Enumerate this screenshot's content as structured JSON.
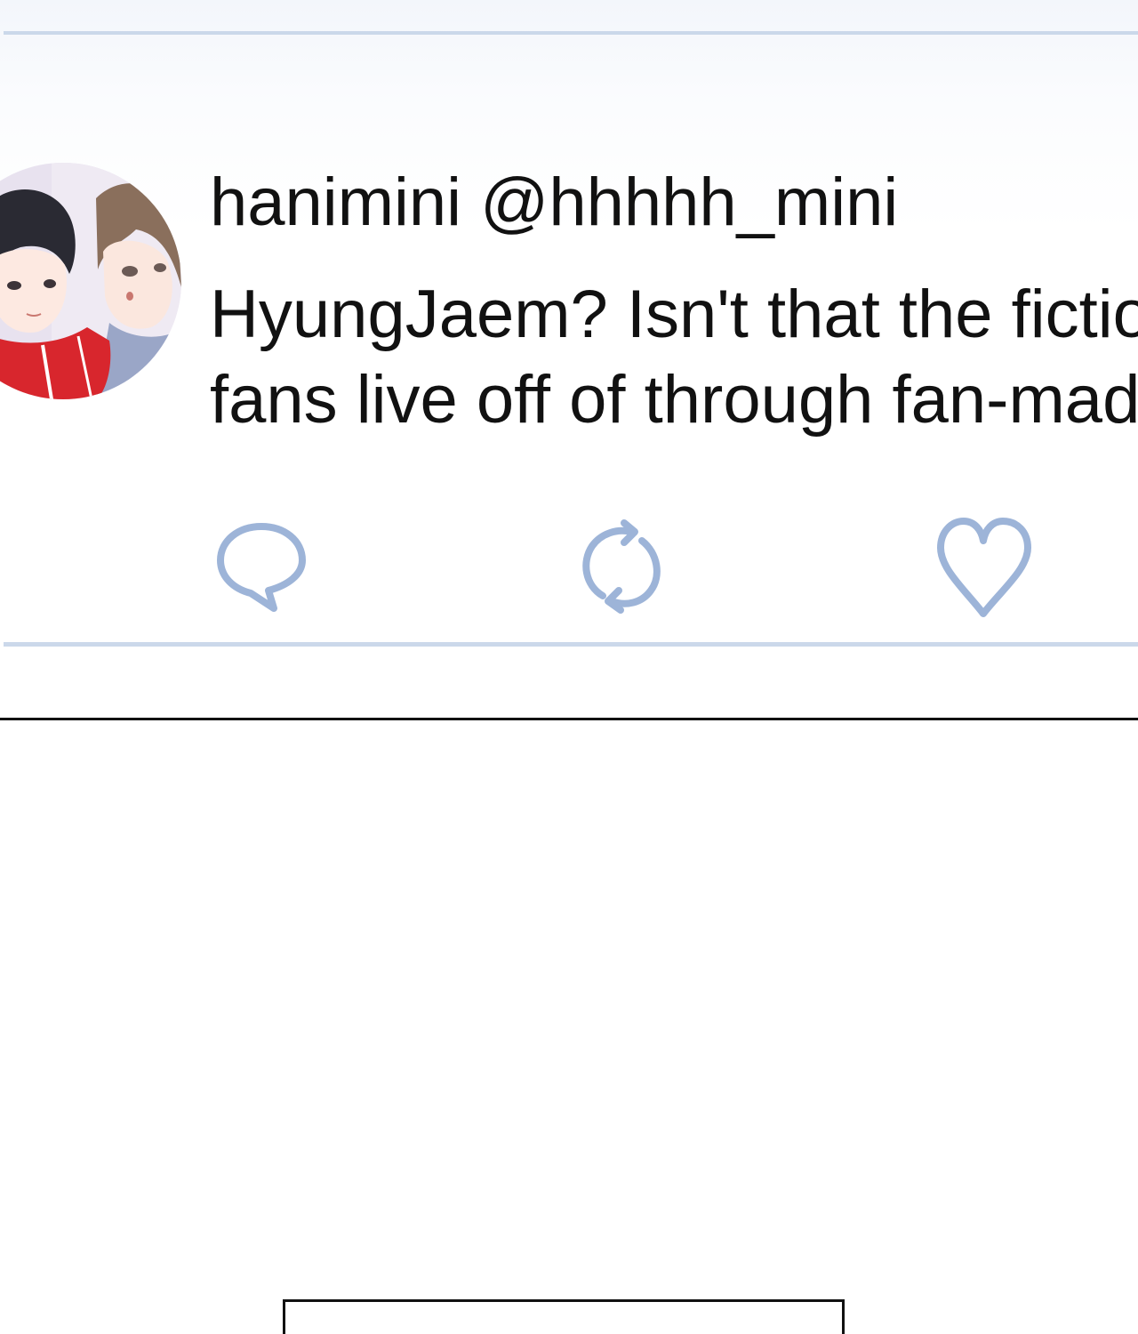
{
  "tweet": {
    "display_name": "hanimini",
    "handle": "@hhhhh_mini",
    "text_lines": [
      "HyungJaem? Isn't that the fictio",
      "fans live off of through fan-mad"
    ],
    "avatar": "avatar-illustration-two-characters"
  },
  "actions": {
    "reply_icon": "speech-bubble-icon",
    "retweet_icon": "retweet-arrows-icon",
    "like_icon": "heart-icon",
    "icon_color": "#9db4d8"
  },
  "colors": {
    "divider": "#cbd8ea",
    "panel_background": "#f3f6fb",
    "text": "#111111",
    "frame_border": "#111111"
  }
}
